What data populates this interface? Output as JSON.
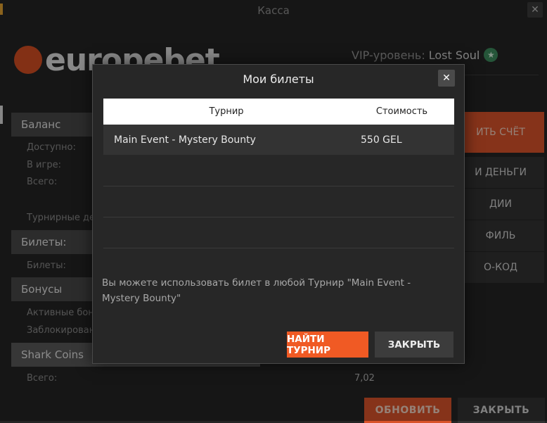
{
  "window": {
    "title": "Касса"
  },
  "brand": {
    "logo_text": "europebet"
  },
  "vip": {
    "label": "VIP-уровень:",
    "name": "Lost Soul"
  },
  "sections": {
    "balance": {
      "title": "Баланс",
      "available": "Доступно:",
      "in_game": "В игре:",
      "total": "Всего:",
      "tournament": "Турнирные де"
    },
    "tickets": {
      "title": "Билеты:",
      "tickets": "Билеты:"
    },
    "bonuses": {
      "title": "Бонусы",
      "active": "Активные бон",
      "blocked": "Заблокирован"
    },
    "shark": {
      "title": "Shark Coins",
      "total": "Всего:",
      "total_value": "7,02"
    }
  },
  "side_menu": [
    "ИТЬ СЧЁТ",
    "И ДЕНЬГИ",
    "ДИИ",
    "ФИЛЬ",
    "О-КОД"
  ],
  "bottom": {
    "refresh": "ОБНОВИТЬ",
    "close": "ЗАКРЫТЬ"
  },
  "modal": {
    "title": "Мои билеты",
    "columns": {
      "tournament": "Турнир",
      "cost": "Стоимость"
    },
    "rows": [
      {
        "tournament": "Main Event - Mystery Bounty",
        "cost": "550 GEL"
      }
    ],
    "message": "Вы можете использовать билет в любой Турнир \"Main Event - Mystery Bounty\"",
    "find_button": "НАЙТИ ТУРНИР",
    "close_button": "ЗАКРЫТЬ"
  },
  "colors": {
    "accent": "#f05a24",
    "bg": "#242424",
    "panel": "#484848"
  }
}
